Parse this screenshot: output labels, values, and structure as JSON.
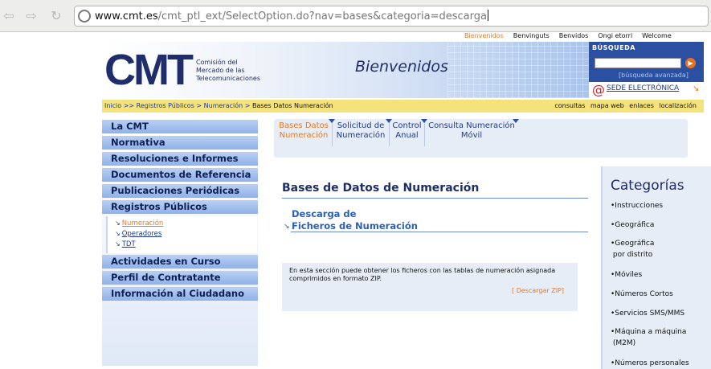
{
  "browser": {
    "back_icon": "back-arrow-icon",
    "forward_icon": "forward-arrow-icon",
    "reload_icon": "reload-icon",
    "url_host": "www.cmt.es",
    "url_path": "/cmt_ptl_ext/SelectOption.do?nav=bases&categoria=descarga"
  },
  "language_bar": {
    "items": [
      "Bienvenidos",
      "Benvinguts",
      "Benvidos",
      "Ongi etorri",
      "Welcome"
    ]
  },
  "header": {
    "logo": "CMT",
    "logo_sub": [
      "Comisión del",
      "Mercado de las",
      "Telecomunicaciones"
    ],
    "welcome": "Bienvenidos"
  },
  "search": {
    "title": "BÚSQUEDA",
    "input_value": "",
    "go_icon": "arrow-right-icon",
    "advanced": "[búsqueda avanzada]"
  },
  "sede": {
    "at_icon": "at-sign-icon",
    "label": "SEDE ELECTRÓNICA",
    "arrow_icon": "arrow-down-right-icon"
  },
  "breadcrumb": {
    "items": [
      "Inicio",
      ">>",
      "Registros Públicos",
      ">",
      "Numeración",
      ">"
    ],
    "current": "Bases Datos Numeración"
  },
  "util_links": [
    "consultas",
    "mapa web",
    "enlaces",
    "localización"
  ],
  "left_menu": {
    "items": [
      "La CMT",
      "Normativa",
      "Resoluciones e Informes",
      "Documentos de Referencia",
      "Publicaciones Periódicas",
      "Registros Públicos",
      "Actividades en Curso",
      "Perfil de Contratante",
      "Información al Ciudadano"
    ],
    "submenu": [
      "Numeración",
      "Operadores",
      "TDT"
    ]
  },
  "tabs": [
    {
      "line1": "Bases Datos",
      "line2": "Numeración"
    },
    {
      "line1": "Solicitud de",
      "line2": "Numeración"
    },
    {
      "line1": "Control",
      "line2": "Anual"
    },
    {
      "line1": "Consulta Numeración",
      "line2": "Móvil"
    }
  ],
  "content": {
    "title": "Bases de Datos de Numeración",
    "download_line1": "Descarga de",
    "download_line2": "Ficheros de Numeración",
    "info_text": "En esta sección puede obtener los ficheros con las tablas de numeración asignada comprimidos en formato ZIP.",
    "zip_link": "[ Descargar ZIP]"
  },
  "categories": {
    "title": "Categorías",
    "items": [
      [
        "•Instrucciones"
      ],
      [
        "•Geográfica"
      ],
      [
        "•Geográfica",
        " por distrito"
      ],
      [
        "•Móviles"
      ],
      [
        "•Números Cortos"
      ],
      [
        "•Servicios SMS/MMS"
      ],
      [
        "•Máquina a máquina",
        " (M2M)"
      ],
      [
        "•Números personales"
      ]
    ]
  },
  "colors": {
    "brand_blue": "#1f2e6b",
    "link_blue": "#1f3a8e",
    "accent_orange": "#e07a2a",
    "breadcrumb_yellow": "#f4e27c",
    "menu_blue": "#8fb1e8"
  }
}
